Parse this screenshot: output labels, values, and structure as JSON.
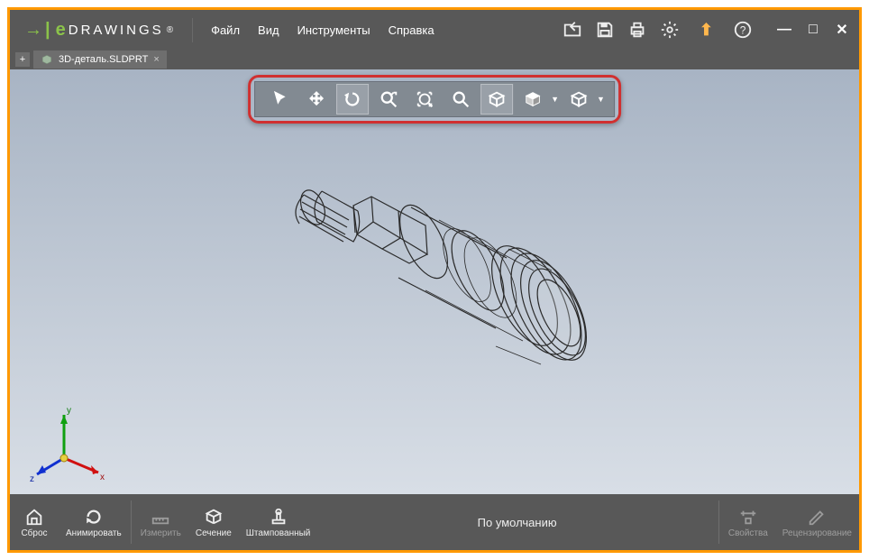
{
  "app": {
    "logo_text": "DRAWINGS",
    "logo_e": "e",
    "trademark": "®"
  },
  "menu": {
    "file": "Файл",
    "view": "Вид",
    "tools": "Инструменты",
    "help": "Справка"
  },
  "tab": {
    "label": "3D-деталь.SLDPRT",
    "close": "×",
    "plus": "+"
  },
  "bottombar": {
    "reset": "Сброс",
    "animate": "Анимировать",
    "measure": "Измерить",
    "section": "Сечение",
    "stamp": "Штампованный",
    "default_text": "По умолчанию",
    "properties": "Свойства",
    "review": "Рецензирование"
  },
  "axes": {
    "x": "x",
    "y": "y",
    "z": "z"
  },
  "floattb_icons": [
    "select",
    "pan",
    "rotate",
    "zoom-fit",
    "zoom-area",
    "zoom",
    "shaded",
    "display-dd",
    "orientation-dd"
  ],
  "winctrl": {
    "min": "—",
    "max": "□",
    "close": "✕"
  }
}
